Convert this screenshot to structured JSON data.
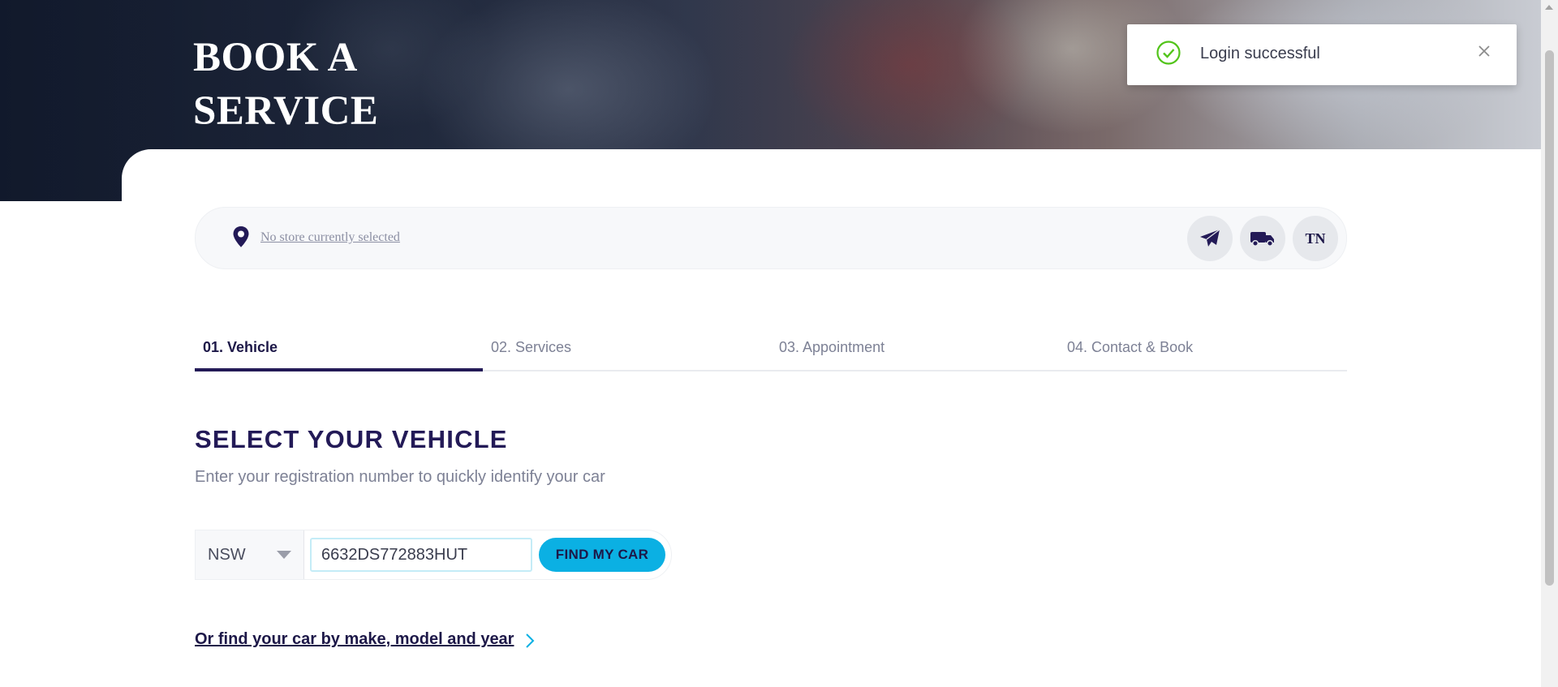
{
  "hero": {
    "title": "BOOK A SERVICE"
  },
  "store_bar": {
    "store_text": "No store currently selected",
    "user_initials": "TN"
  },
  "tabs": [
    {
      "label": "01. Vehicle",
      "active": true
    },
    {
      "label": "02. Services",
      "active": false
    },
    {
      "label": "03. Appointment",
      "active": false
    },
    {
      "label": "04. Contact & Book",
      "active": false
    }
  ],
  "section": {
    "title": "SELECT YOUR VEHICLE",
    "subtitle": "Enter your registration number to quickly identify your car"
  },
  "rego_form": {
    "state": "NSW",
    "rego_value": "6632DS772883HUT",
    "find_button": "FIND MY CAR"
  },
  "alt_link": "Or find your car by make, model and year",
  "toast": {
    "message": "Login successful"
  },
  "colors": {
    "brand_navy": "#231a57",
    "accent_cyan": "#0bb0e3",
    "success_green": "#52c41a"
  },
  "icons": [
    "location-pin-icon",
    "send-icon",
    "truck-icon",
    "check-circle-icon",
    "close-icon",
    "chevron-right-icon",
    "caret-down-icon"
  ]
}
